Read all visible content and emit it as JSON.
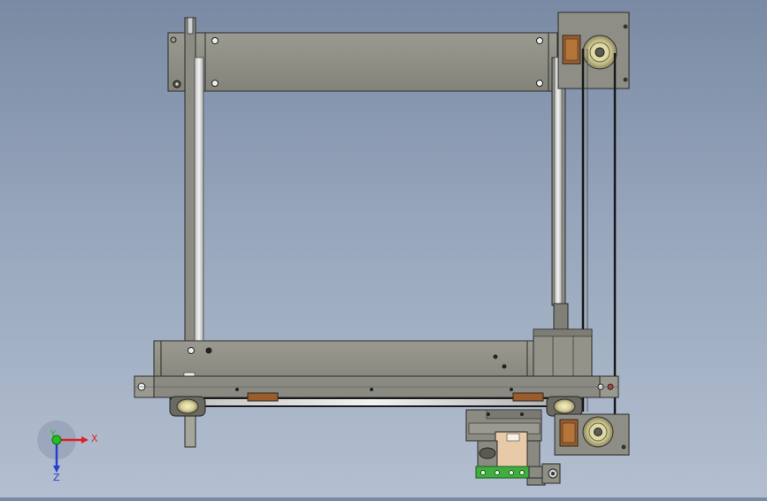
{
  "view": {
    "background_top": "#7a8aa4",
    "background_bottom": "#b3bfd0",
    "part_color": "#8f8f86",
    "part_edge": "#2a2a2a",
    "rail_color": "#d8d8d8",
    "belt_color": "#1a1a1a",
    "bracket_color": "#9a5c2a",
    "cart_color": "#e8c9a8",
    "highlight_green": "#3fae3f"
  },
  "triad": {
    "x_label": "X",
    "y_label": "Y",
    "z_label": "Z",
    "x_color": "#e02020",
    "y_color": "#20c020",
    "z_color": "#2040d0"
  }
}
